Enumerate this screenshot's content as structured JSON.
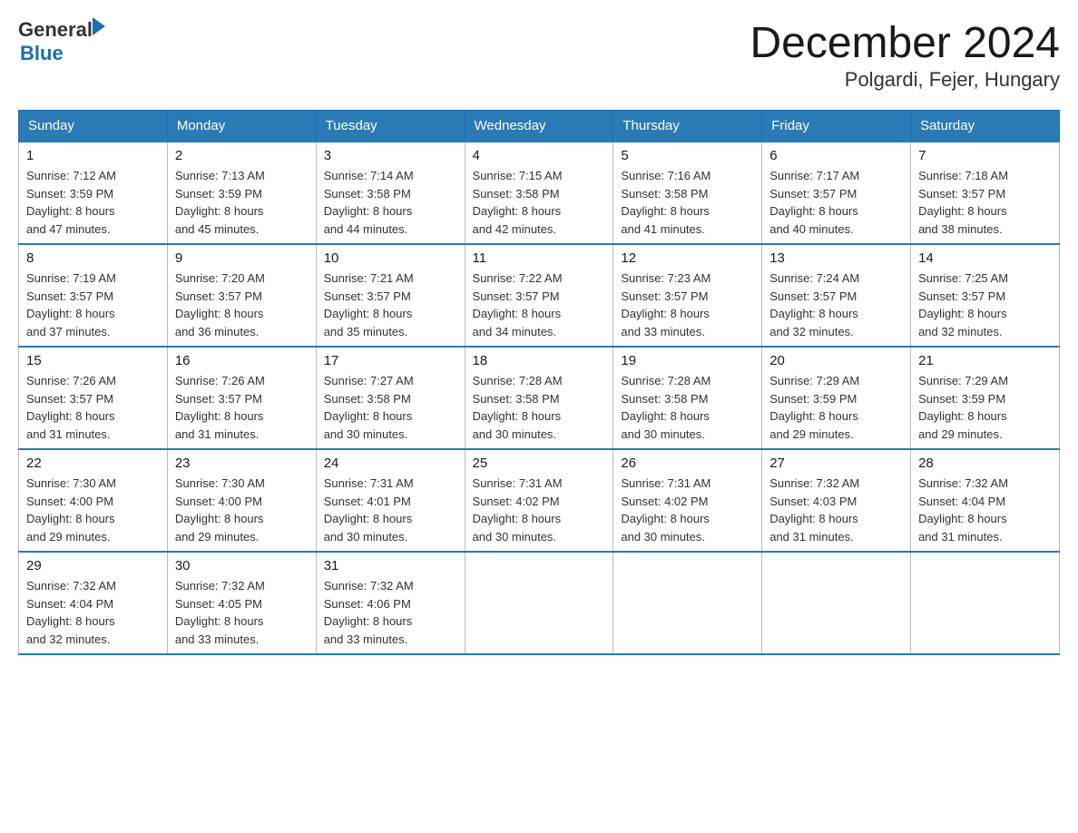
{
  "header": {
    "logo_general": "General",
    "logo_blue": "Blue",
    "month_title": "December 2024",
    "location": "Polgardi, Fejer, Hungary"
  },
  "days_of_week": [
    "Sunday",
    "Monday",
    "Tuesday",
    "Wednesday",
    "Thursday",
    "Friday",
    "Saturday"
  ],
  "weeks": [
    [
      {
        "day": "1",
        "sunrise": "7:12 AM",
        "sunset": "3:59 PM",
        "daylight": "8 hours and 47 minutes."
      },
      {
        "day": "2",
        "sunrise": "7:13 AM",
        "sunset": "3:59 PM",
        "daylight": "8 hours and 45 minutes."
      },
      {
        "day": "3",
        "sunrise": "7:14 AM",
        "sunset": "3:58 PM",
        "daylight": "8 hours and 44 minutes."
      },
      {
        "day": "4",
        "sunrise": "7:15 AM",
        "sunset": "3:58 PM",
        "daylight": "8 hours and 42 minutes."
      },
      {
        "day": "5",
        "sunrise": "7:16 AM",
        "sunset": "3:58 PM",
        "daylight": "8 hours and 41 minutes."
      },
      {
        "day": "6",
        "sunrise": "7:17 AM",
        "sunset": "3:57 PM",
        "daylight": "8 hours and 40 minutes."
      },
      {
        "day": "7",
        "sunrise": "7:18 AM",
        "sunset": "3:57 PM",
        "daylight": "8 hours and 38 minutes."
      }
    ],
    [
      {
        "day": "8",
        "sunrise": "7:19 AM",
        "sunset": "3:57 PM",
        "daylight": "8 hours and 37 minutes."
      },
      {
        "day": "9",
        "sunrise": "7:20 AM",
        "sunset": "3:57 PM",
        "daylight": "8 hours and 36 minutes."
      },
      {
        "day": "10",
        "sunrise": "7:21 AM",
        "sunset": "3:57 PM",
        "daylight": "8 hours and 35 minutes."
      },
      {
        "day": "11",
        "sunrise": "7:22 AM",
        "sunset": "3:57 PM",
        "daylight": "8 hours and 34 minutes."
      },
      {
        "day": "12",
        "sunrise": "7:23 AM",
        "sunset": "3:57 PM",
        "daylight": "8 hours and 33 minutes."
      },
      {
        "day": "13",
        "sunrise": "7:24 AM",
        "sunset": "3:57 PM",
        "daylight": "8 hours and 32 minutes."
      },
      {
        "day": "14",
        "sunrise": "7:25 AM",
        "sunset": "3:57 PM",
        "daylight": "8 hours and 32 minutes."
      }
    ],
    [
      {
        "day": "15",
        "sunrise": "7:26 AM",
        "sunset": "3:57 PM",
        "daylight": "8 hours and 31 minutes."
      },
      {
        "day": "16",
        "sunrise": "7:26 AM",
        "sunset": "3:57 PM",
        "daylight": "8 hours and 31 minutes."
      },
      {
        "day": "17",
        "sunrise": "7:27 AM",
        "sunset": "3:58 PM",
        "daylight": "8 hours and 30 minutes."
      },
      {
        "day": "18",
        "sunrise": "7:28 AM",
        "sunset": "3:58 PM",
        "daylight": "8 hours and 30 minutes."
      },
      {
        "day": "19",
        "sunrise": "7:28 AM",
        "sunset": "3:58 PM",
        "daylight": "8 hours and 30 minutes."
      },
      {
        "day": "20",
        "sunrise": "7:29 AM",
        "sunset": "3:59 PM",
        "daylight": "8 hours and 29 minutes."
      },
      {
        "day": "21",
        "sunrise": "7:29 AM",
        "sunset": "3:59 PM",
        "daylight": "8 hours and 29 minutes."
      }
    ],
    [
      {
        "day": "22",
        "sunrise": "7:30 AM",
        "sunset": "4:00 PM",
        "daylight": "8 hours and 29 minutes."
      },
      {
        "day": "23",
        "sunrise": "7:30 AM",
        "sunset": "4:00 PM",
        "daylight": "8 hours and 29 minutes."
      },
      {
        "day": "24",
        "sunrise": "7:31 AM",
        "sunset": "4:01 PM",
        "daylight": "8 hours and 30 minutes."
      },
      {
        "day": "25",
        "sunrise": "7:31 AM",
        "sunset": "4:02 PM",
        "daylight": "8 hours and 30 minutes."
      },
      {
        "day": "26",
        "sunrise": "7:31 AM",
        "sunset": "4:02 PM",
        "daylight": "8 hours and 30 minutes."
      },
      {
        "day": "27",
        "sunrise": "7:32 AM",
        "sunset": "4:03 PM",
        "daylight": "8 hours and 31 minutes."
      },
      {
        "day": "28",
        "sunrise": "7:32 AM",
        "sunset": "4:04 PM",
        "daylight": "8 hours and 31 minutes."
      }
    ],
    [
      {
        "day": "29",
        "sunrise": "7:32 AM",
        "sunset": "4:04 PM",
        "daylight": "8 hours and 32 minutes."
      },
      {
        "day": "30",
        "sunrise": "7:32 AM",
        "sunset": "4:05 PM",
        "daylight": "8 hours and 33 minutes."
      },
      {
        "day": "31",
        "sunrise": "7:32 AM",
        "sunset": "4:06 PM",
        "daylight": "8 hours and 33 minutes."
      },
      null,
      null,
      null,
      null
    ]
  ],
  "labels": {
    "sunrise": "Sunrise:",
    "sunset": "Sunset:",
    "daylight": "Daylight:"
  }
}
